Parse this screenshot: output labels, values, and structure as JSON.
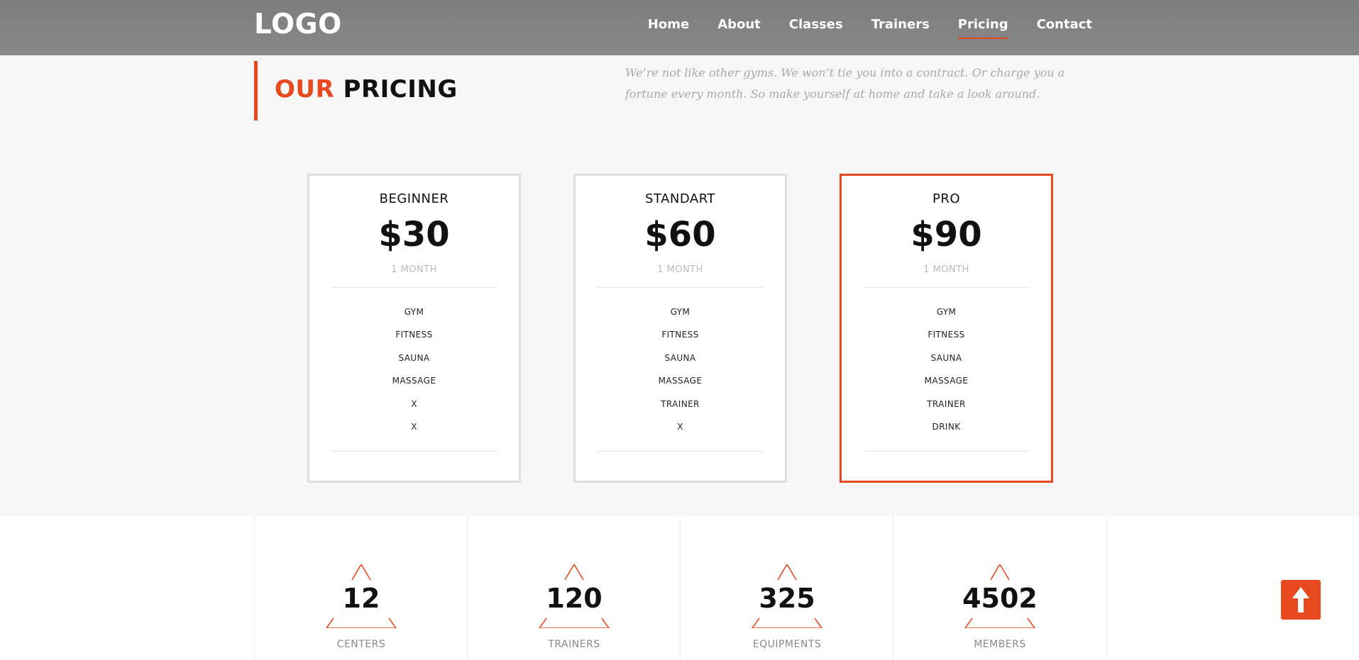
{
  "header": {
    "logo": "LOGO",
    "nav": [
      {
        "label": "Home",
        "active": false
      },
      {
        "label": "About",
        "active": false
      },
      {
        "label": "Classes",
        "active": false
      },
      {
        "label": "Trainers",
        "active": false
      },
      {
        "label": "Pricing",
        "active": true
      },
      {
        "label": "Contact",
        "active": false
      }
    ]
  },
  "section": {
    "title_accent": "OUR",
    "title_rest": "PRICING",
    "intro": "We’re not like other gyms. We won’t tie you into a contract. Or charge you a fortune every month. So make yourself at home and take a look around."
  },
  "plans": [
    {
      "name": "BEGINNER",
      "price": "$30",
      "period": "1 MONTH",
      "features": [
        "GYM",
        "FITNESS",
        "SAUNA",
        "MASSAGE",
        "X",
        "X"
      ]
    },
    {
      "name": "STANDART",
      "price": "$60",
      "period": "1 MONTH",
      "features": [
        "GYM",
        "FITNESS",
        "SAUNA",
        "MASSAGE",
        "TRAINER",
        "X"
      ]
    },
    {
      "name": "PRO",
      "price": "$90",
      "period": "1 MONTH",
      "features": [
        "GYM",
        "FITNESS",
        "SAUNA",
        "MASSAGE",
        "TRAINER",
        "DRINK"
      ]
    }
  ],
  "stats": [
    {
      "number": "12",
      "label": "CENTERS"
    },
    {
      "number": "120",
      "label": "TRAINERS"
    },
    {
      "number": "325",
      "label": "EQUIPMENTS"
    },
    {
      "number": "4502",
      "label": "MEMBERS"
    }
  ],
  "colors": {
    "accent": "#e84a1f",
    "header": "#808080",
    "background": "#f7f7f7"
  },
  "icons": {
    "scroll_top": "arrow-up-icon",
    "stat_frame": "triangle-icon"
  }
}
